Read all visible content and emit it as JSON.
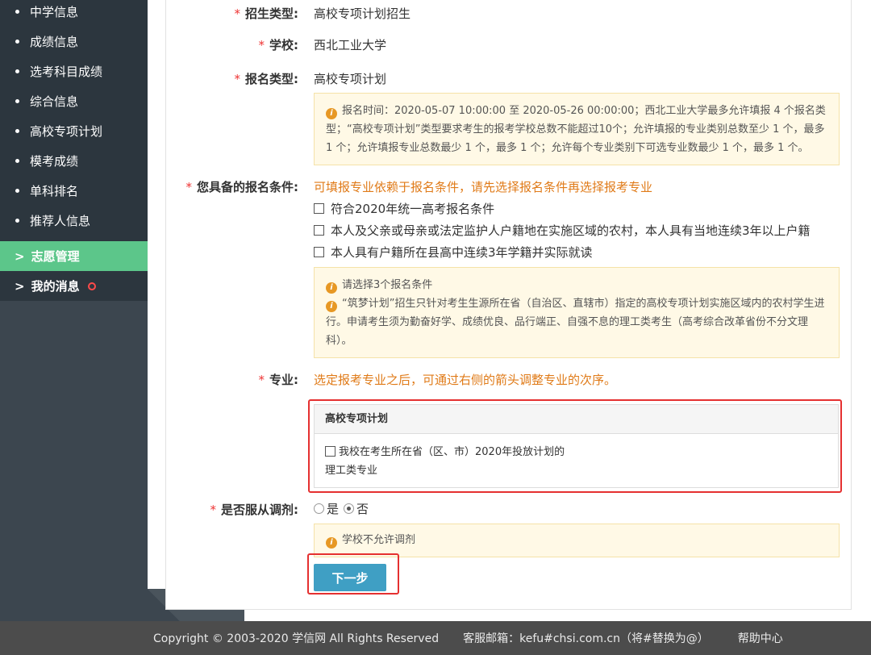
{
  "sidebar": {
    "sub_items": [
      {
        "label": "中学信息"
      },
      {
        "label": "成绩信息"
      },
      {
        "label": "选考科目成绩"
      },
      {
        "label": "综合信息"
      },
      {
        "label": "高校专项计划"
      },
      {
        "label": "模考成绩"
      },
      {
        "label": "单科排名"
      },
      {
        "label": "推荐人信息"
      }
    ],
    "sections": [
      {
        "label": "志愿管理",
        "chevron": ">"
      },
      {
        "label": "我的消息",
        "chevron": ">"
      }
    ]
  },
  "form": {
    "admission_type": {
      "label": "招生类型:",
      "value": "高校专项计划招生"
    },
    "school": {
      "label": "学校:",
      "value": "西北工业大学"
    },
    "apply_type": {
      "label": "报名类型:",
      "value": "高校专项计划"
    },
    "apply_notice": "报名时间：2020-05-07 10:00:00 至 2020-05-26 00:00:00；西北工业大学最多允许填报 4 个报名类型；“高校专项计划”类型要求考生的报考学校总数不能超过10个；允许填报的专业类别总数至少 1 个，最多 1 个；允许填报专业总数最少 1 个，最多 1 个；允许每个专业类别下可选专业数最少 1 个，最多 1 个。",
    "conditions": {
      "label": "您具备的报名条件:",
      "hint": "可填报专业依赖于报名条件，请先选择报名条件再选择报考专业",
      "options": [
        "符合2020年统一高考报名条件",
        "本人及父亲或母亲或法定监护人户籍地在实施区域的农村，本人具有当地连续3年以上户籍",
        "本人具有户籍所在县高中连续3年学籍并实际就读"
      ],
      "notice_1": "请选择3个报名条件",
      "notice_2": "“筑梦计划”招生只针对考生生源所在省（自治区、直辖市）指定的高校专项计划实施区域内的农村学生进行。申请考生须为勤奋好学、成绩优良、品行端正、自强不息的理工类考生（高考综合改革省份不分文理科）。"
    },
    "major": {
      "label": "专业:",
      "hint": "选定报考专业之后，可通过右侧的箭头调整专业的次序。",
      "box_title": "高校专项计划",
      "item": "我校在考生所在省（区、市）2020年投放计划的理工类专业"
    },
    "adjust": {
      "label": "是否服从调剂:",
      "yes": "是",
      "no": "否",
      "selected": "否",
      "notice": "学校不允许调剂"
    },
    "next_button": "下一步"
  },
  "footer": {
    "copyright": "Copyright © 2003-2020 学信网 All Rights Reserved",
    "email": "客服邮箱：kefu#chsi.com.cn（将#替换为@）",
    "help": "帮助中心"
  },
  "colors": {
    "sidebar_bg": "#2c363e",
    "active_section": "#5cc68a",
    "required_mark": "#e33333",
    "hint_orange": "#e07b19",
    "notice_bg": "#fff9e6",
    "button_bg": "#3f9fc4",
    "highlight_frame": "#e53030",
    "footer_bg": "#4c4c4c"
  }
}
